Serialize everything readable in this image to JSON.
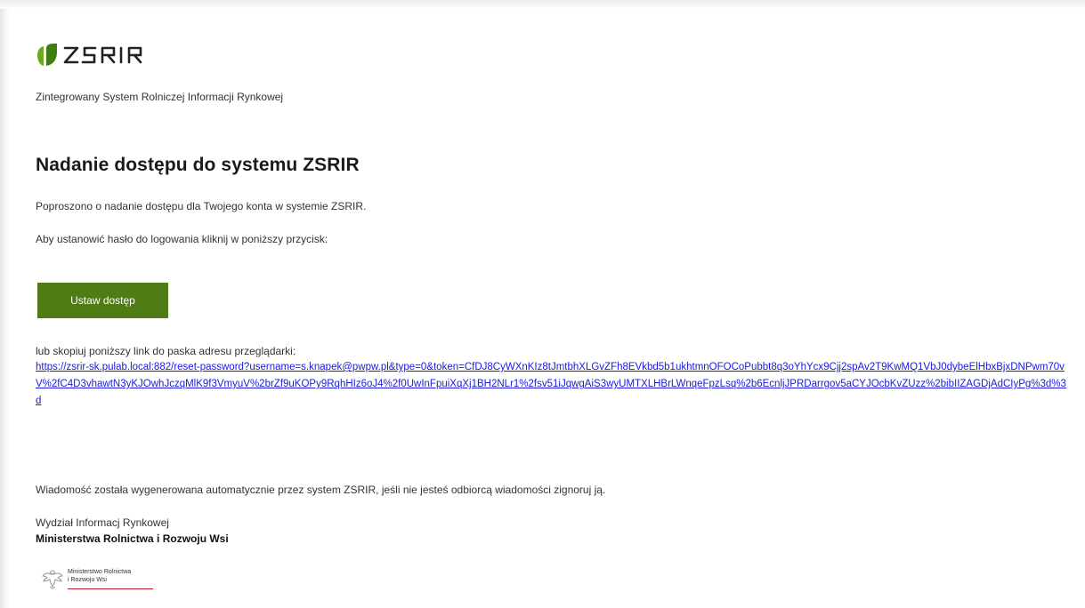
{
  "header": {
    "logo_text": "ZSRIR",
    "tagline": "Zintegrowany System Rolniczej Informacji Rynkowej"
  },
  "content": {
    "title": "Nadanie dostępu do systemu ZSRIR",
    "paragraph1": "Poproszono o nadanie dostępu dla Twojego konta w systemie ZSRIR.",
    "paragraph2": "Aby ustanowić hasło do logowania kliknij w poniższy przycisk:",
    "button_label": "Ustaw dostęp",
    "copy_link_label": "lub skopiuj poniższy link do paska adresu przeglądarki:",
    "reset_link": "https://zsrir-sk.pulab.local:882/reset-password?username=s.knapek@pwpw.pl&type=0&token=CfDJ8CyWXnKIz8tJmtbhXLGvZFh8EVkbd5b1ukhtmnOFOCoPubbt8q3oYhYcx9Cjj2spAv2T9KwMQ1VbJ0dybeElHbxBjxDNPwm70vV%2fC4D3vhawtN3yKJOwhJczqMlK9f3VmyuV%2brZf9uKOPy9RqhHIz6oJ4%2f0UwInFpuiXqXj1BH2NLr1%2fsv51iJqwgAiS3wyUMTXLHBrLWnqeFpzLsq%2b6EcnljJPRDarrgov5aCYJOcbKvZUzz%2bibIIZAGDjAdCIyPg%3d%3d",
    "auto_note": "Wiadomość została wygenerowana automatycznie przez system ZSRIR, jeśli nie jesteś odbiorcą wiadomości zignoruj ją.",
    "department": "Wydział Informacj Rynkowej",
    "ministry": "Ministerstwa Rolnictwa i Rozwoju Wsi"
  },
  "footer_logo": {
    "line1": "Ministerstwo Rolnictwa",
    "line2": "i Rozwoju Wsi"
  },
  "colors": {
    "button": "#4f7c14",
    "link": "#1a1ae0",
    "logo_green": "#5a9a1a",
    "ministry_red": "#c8102e"
  }
}
